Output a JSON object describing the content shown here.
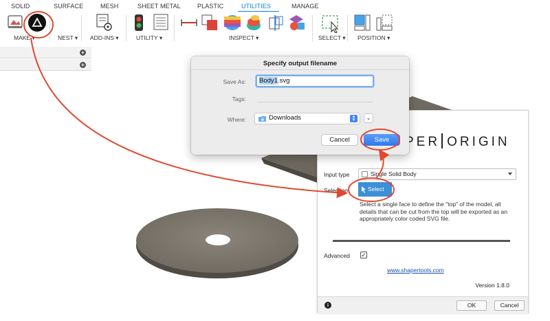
{
  "ribbon": {
    "tabs": [
      {
        "label": "SOLID"
      },
      {
        "label": "SURFACE"
      },
      {
        "label": "MESH"
      },
      {
        "label": "SHEET METAL"
      },
      {
        "label": "PLASTIC"
      },
      {
        "label": "UTILITIES"
      },
      {
        "label": "MANAGE"
      }
    ],
    "active_tab": "UTILITIES",
    "groups": [
      {
        "label": "MAKE ▾"
      },
      {
        "label": "NEST ▾"
      },
      {
        "label": "ADD-INS ▾"
      },
      {
        "label": "UTILITY ▾"
      },
      {
        "label": "INSPECT ▾"
      },
      {
        "label": "SELECT ▾"
      },
      {
        "label": "POSITION ▾"
      }
    ]
  },
  "save_dialog": {
    "title": "Specify output filename",
    "save_as_label": "Save As:",
    "filename_selected": "Body1",
    "filename_ext": ".svg",
    "tags_label": "Tags:",
    "where_label": "Where:",
    "where_value": "Downloads",
    "cancel_label": "Cancel",
    "save_label": "Save"
  },
  "shaper_panel": {
    "logo_left": "PER",
    "logo_right": "ORIGIN",
    "input_type_label": "Input type",
    "input_type_value": "Single Solid Body",
    "selection_label": "Selection",
    "select_button": "Select",
    "description": "Select a single face to define the \"top\" of the model, all details that can be cut from the top will be exported as an appropriately color coded SVG file.",
    "advanced_label": "Advanced",
    "advanced_checked": "✓",
    "link": "www.shapertools.com",
    "version": "Version 1.8.0",
    "ok_label": "OK",
    "cancel_label": "Cancel"
  },
  "colors": {
    "accent_blue": "#0d7fe0",
    "save_button": "#2f78f0",
    "annotation_red": "#e0482f",
    "select_button": "#3d8fd6"
  }
}
